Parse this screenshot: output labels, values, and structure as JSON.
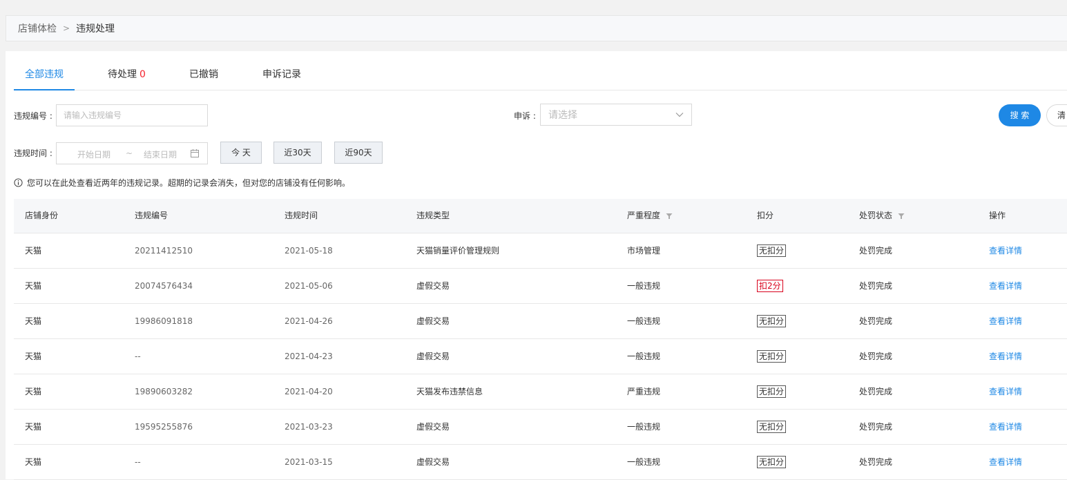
{
  "breadcrumb": {
    "parent": "店铺体检",
    "separator": ">",
    "current": "违规处理"
  },
  "tabs": [
    {
      "label": "全部违规",
      "count": ""
    },
    {
      "label": "待处理",
      "count": "0"
    },
    {
      "label": "已撤销",
      "count": ""
    },
    {
      "label": "申诉记录",
      "count": ""
    }
  ],
  "filters": {
    "violation_no_label": "违规编号 :",
    "violation_no_placeholder": "请输入违规编号",
    "appeal_label": "申诉 :",
    "appeal_placeholder": "请选择",
    "time_label": "违规时间 :",
    "start_date_placeholder": "开始日期",
    "date_separator": "~",
    "end_date_placeholder": "结束日期",
    "quick_today": "今 天",
    "quick_30": "近30天",
    "quick_90": "近90天",
    "search_button": "搜 索",
    "clear_button": "清"
  },
  "notice": "您可以在此处查看近两年的违规记录。超期的记录会消失，但对您的店铺没有任何影响。",
  "table": {
    "columns": [
      "店铺身份",
      "违规编号",
      "违规时间",
      "违规类型",
      "严重程度",
      "扣分",
      "处罚状态",
      "操作"
    ],
    "rows": [
      {
        "shop": "天猫",
        "id": "20211412510",
        "time": "2021-05-18",
        "type": "天猫销量评价管理规则",
        "severity": "市场管理",
        "deduct": "无扣分",
        "deduct_red": false,
        "status": "处罚完成",
        "action": "查看详情"
      },
      {
        "shop": "天猫",
        "id": "20074576434",
        "time": "2021-05-06",
        "type": "虚假交易",
        "severity": "一般违规",
        "deduct": "扣2分",
        "deduct_red": true,
        "status": "处罚完成",
        "action": "查看详情"
      },
      {
        "shop": "天猫",
        "id": "19986091818",
        "time": "2021-04-26",
        "type": "虚假交易",
        "severity": "一般违规",
        "deduct": "无扣分",
        "deduct_red": false,
        "status": "处罚完成",
        "action": "查看详情"
      },
      {
        "shop": "天猫",
        "id": "--",
        "time": "2021-04-23",
        "type": "虚假交易",
        "severity": "一般违规",
        "deduct": "无扣分",
        "deduct_red": false,
        "status": "处罚完成",
        "action": "查看详情"
      },
      {
        "shop": "天猫",
        "id": "19890603282",
        "time": "2021-04-20",
        "type": "天猫发布违禁信息",
        "severity": "严重违规",
        "deduct": "无扣分",
        "deduct_red": false,
        "status": "处罚完成",
        "action": "查看详情"
      },
      {
        "shop": "天猫",
        "id": "19595255876",
        "time": "2021-03-23",
        "type": "虚假交易",
        "severity": "一般违规",
        "deduct": "无扣分",
        "deduct_red": false,
        "status": "处罚完成",
        "action": "查看详情"
      },
      {
        "shop": "天猫",
        "id": "--",
        "time": "2021-03-15",
        "type": "虚假交易",
        "severity": "一般违规",
        "deduct": "无扣分",
        "deduct_red": false,
        "status": "处罚完成",
        "action": "查看详情"
      }
    ]
  },
  "colors": {
    "accent": "#1e88e5",
    "danger": "#d9001b",
    "count_red": "#f5222d"
  },
  "icons": [
    "info-circle-icon",
    "chevron-down-icon",
    "calendar-icon",
    "filter-icon"
  ]
}
